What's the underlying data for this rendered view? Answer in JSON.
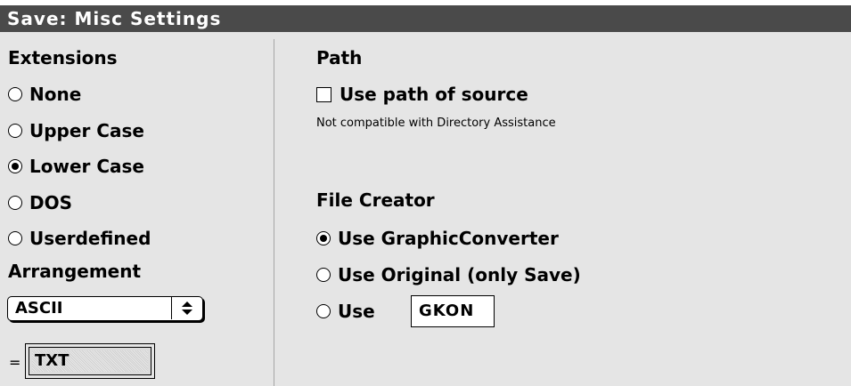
{
  "window": {
    "title": "Save: Misc Settings"
  },
  "extensions": {
    "heading": "Extensions",
    "options": [
      {
        "label": "None",
        "selected": false
      },
      {
        "label": "Upper Case",
        "selected": false
      },
      {
        "label": "Lower Case",
        "selected": true
      },
      {
        "label": "DOS",
        "selected": false
      },
      {
        "label": "Userdefined",
        "selected": false
      }
    ]
  },
  "arrangement": {
    "heading": "Arrangement",
    "selected": "ASCII",
    "prefix": "=",
    "extension_value": "TXT"
  },
  "path": {
    "heading": "Path",
    "checkbox_label": "Use path of source",
    "checked": false,
    "note": "Not compatible with Directory Assistance"
  },
  "file_creator": {
    "heading": "File Creator",
    "options": [
      {
        "label": "Use GraphicConverter",
        "selected": true
      },
      {
        "label": "Use Original (only Save)",
        "selected": false
      },
      {
        "label": "Use",
        "selected": false
      }
    ],
    "custom_code": "GKON"
  }
}
